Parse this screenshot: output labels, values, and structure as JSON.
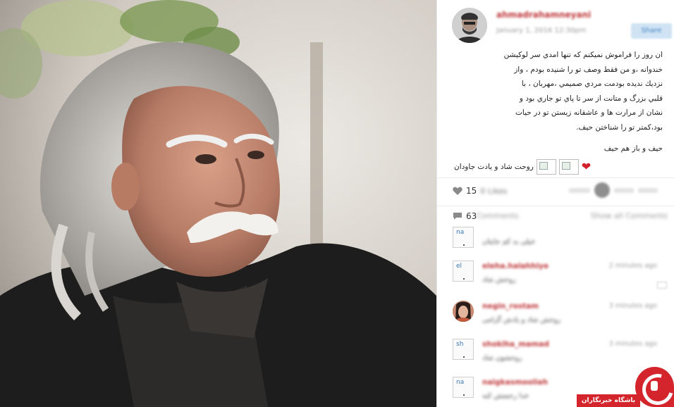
{
  "post": {
    "username": "ahmadrahamneyani",
    "date": "January 1, 2016 12:30pm",
    "share_label": "Share",
    "caption_lines": [
      "ان روز را فراموش نميكنم كه تنها امدي سر لوكيشن",
      "خندوانه ،و من فقط وصف تو را شنيده بودم ، واز",
      "نزديك نديده بودمت مردي صميمي ،مهربان ، با",
      "قلبي بزرگ و متانت از سر تا پاي تو جاري بود و",
      "نشان از مرارت ها و عاشقانه زيستن تو در حيات",
      "بود،كمتر تو را شناختن حيف."
    ],
    "caption_regret": "حيف و باز هم حيف",
    "caption_signoff": "روحت شاد و يادت جاودان",
    "heart_glyph": "❤"
  },
  "stats": {
    "likes_count": "15",
    "likes_label": "0 Likes",
    "comments_count": "63",
    "comments_label": "Comments",
    "show_all_label": "Show all Comments"
  },
  "comments": [
    {
      "thumb_text": "na",
      "avatar": "broken",
      "name": "",
      "time": "",
      "text": "خیلی بد کم جایتان"
    },
    {
      "thumb_text": "el",
      "avatar": "broken",
      "name": "eleha.halahhiye",
      "time": "2 minutes ago",
      "text": "روحش شاد"
    },
    {
      "thumb_text": "",
      "avatar": "photo",
      "name": "negin_rostam",
      "time": "3 minutes ago",
      "text": "روحش شاد و یادش گرامی"
    },
    {
      "thumb_text": "sh",
      "avatar": "broken",
      "name": "shokiha_mamad",
      "time": "3 minutes ago",
      "text": "روحشون شاد"
    },
    {
      "thumb_text": "na",
      "avatar": "broken",
      "name": "naigkasmooliah",
      "time": "4 minutes ago",
      "text": "خدا رحمتش کنه"
    }
  ],
  "watermark": {
    "label": "باشگاه خبرنگاران"
  },
  "colors": {
    "link_red": "#c0393b",
    "heart_red": "#d2202a",
    "brand_red": "#d3252b"
  }
}
